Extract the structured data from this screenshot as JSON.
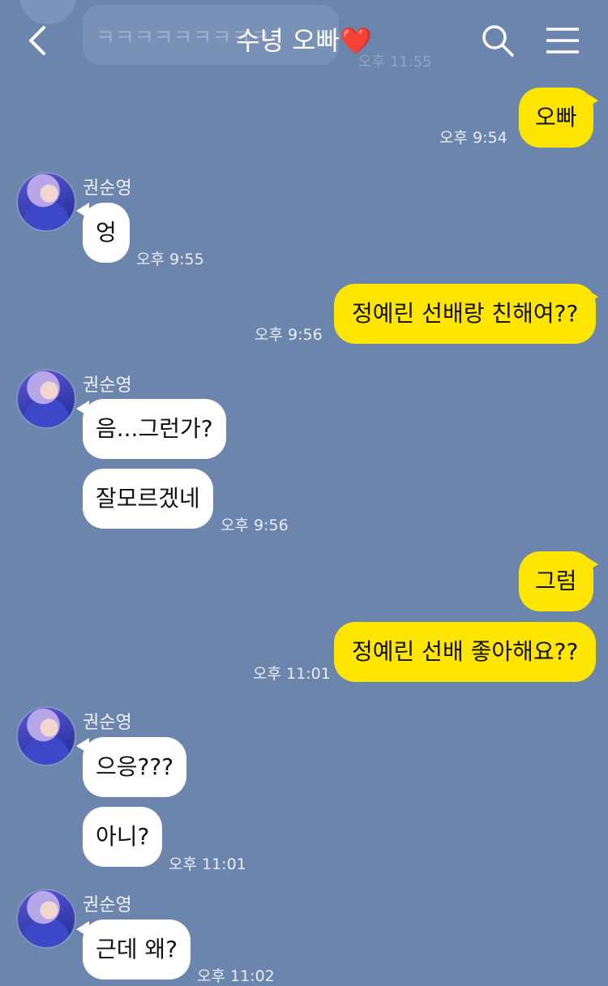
{
  "header": {
    "back_label": "<",
    "title": "수녕 오빠",
    "title_emoji": "❤️"
  },
  "ghost": {
    "text": "ㅋㅋㅋㅋㅋㅋㅋㅋㅋ",
    "time": "오후 11:55"
  },
  "messages": [
    {
      "from": "me",
      "text": "오빠",
      "time": "오후 9:54"
    },
    {
      "from": "them",
      "sender": "권순영",
      "text": "엉",
      "time": "오후 9:55"
    },
    {
      "from": "me",
      "text": "정예린 선배랑 친해여??",
      "time": "오후 9:56"
    },
    {
      "from": "them",
      "sender": "권순영",
      "text": "음...그런가?"
    },
    {
      "from": "them",
      "text": "잘모르겠네",
      "time": "오후 9:56"
    },
    {
      "from": "me",
      "text": "그럼"
    },
    {
      "from": "me",
      "text": "정예린 선배 좋아해요??",
      "time": "오후 11:01"
    },
    {
      "from": "them",
      "sender": "권순영",
      "text": "으응???"
    },
    {
      "from": "them",
      "text": "아니?",
      "time": "오후 11:01"
    },
    {
      "from": "them",
      "sender": "권순영",
      "text": "근데 왜?",
      "time": "오후 11:02"
    }
  ],
  "colors": {
    "background": "#6b85ad",
    "my_bubble": "#fee500",
    "their_bubble": "#ffffff"
  }
}
